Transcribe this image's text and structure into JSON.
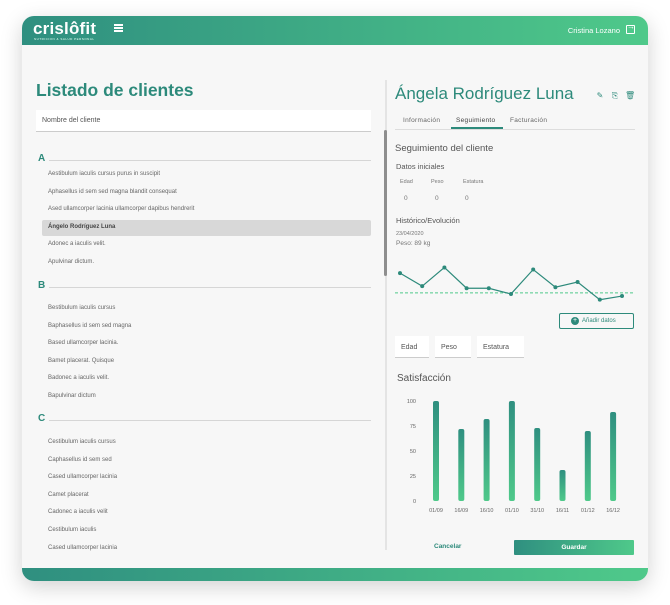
{
  "header": {
    "logo": "crislôfit",
    "logo_sub": "NUTRICION & SALUD PERSONAL",
    "user": "Cristina Lozano"
  },
  "list": {
    "title": "Listado de clientes",
    "search_placeholder": "Nombre del cliente",
    "groups": [
      {
        "letter": "A",
        "clients": [
          "Aestibulum iaculis cursus purus in suscipit",
          "Aphasellus id sem sed magna blandit consequat",
          "Ased ullamcorper lacinia ullamcorper dapibus hendrerit",
          "Ángelo Rodríguez Luna",
          "Adonec a iaculis velit.",
          "Apulvinar dictum."
        ]
      },
      {
        "letter": "B",
        "clients": [
          "Bestibulum iaculis cursus",
          "Baphasellus id sem sed magna",
          "Based ullamcorper lacinia.",
          "Bamet placerat. Quisque",
          "Badonec a iaculis velit.",
          "Bapulvinar dictum"
        ]
      },
      {
        "letter": "C",
        "clients": [
          "Cestibulum iaculis cursus",
          "Caphasellus id sem sed",
          "Cased ullamcorper lacinia",
          "Camet placerat",
          "Cadonec a iaculis velit",
          "Cestibulum iaculis",
          "Cased ullamcorper lacinia"
        ]
      }
    ]
  },
  "detail": {
    "name": "Ángela Rodríguez Luna",
    "tabs": [
      "Información",
      "Seguimiento",
      "Facturación"
    ],
    "section_title": "Seguimiento del cliente",
    "initial_title": "Datos iniciales",
    "initial_labels": [
      "Edad",
      "Peso",
      "Estatura"
    ],
    "initial_values": [
      "0",
      "0",
      "0"
    ],
    "history_title": "Histórico/Evolución",
    "history_date": "23/04/2020",
    "history_weight": "Peso: 89 kg",
    "add_button": "Añadir datos",
    "fields": [
      "Edad",
      "Peso",
      "Estatura"
    ],
    "satisfaction_title": "Satisfacción",
    "cancel": "Cancelar",
    "save": "Guardar"
  },
  "colors": {
    "accent": "#2d8a7b",
    "gradient_start": "#2f8f80",
    "gradient_end": "#4fc98a"
  },
  "icons": [
    "edit-icon",
    "export-icon",
    "delete-icon",
    "logout-icon",
    "menu-icon",
    "plus-icon"
  ],
  "chart_data": [
    {
      "type": "line",
      "title": "",
      "series": [
        {
          "values": [
            0.67,
            0.42,
            0.78,
            0.38,
            0.38,
            0.27,
            0.74,
            0.4,
            0.5,
            0.16,
            0.23
          ]
        }
      ],
      "baseline": 0.29,
      "ylim": [
        0,
        1
      ]
    },
    {
      "type": "bar",
      "title": "Satisfacción",
      "categories": [
        "01/09",
        "16/09",
        "16/10",
        "01/10",
        "31/10",
        "16/11",
        "01/12",
        "16/12"
      ],
      "values": [
        100,
        72,
        82,
        100,
        73,
        31,
        70,
        89
      ],
      "yticks": [
        0,
        25,
        50,
        75,
        100
      ],
      "ylim": [
        0,
        100
      ]
    }
  ]
}
